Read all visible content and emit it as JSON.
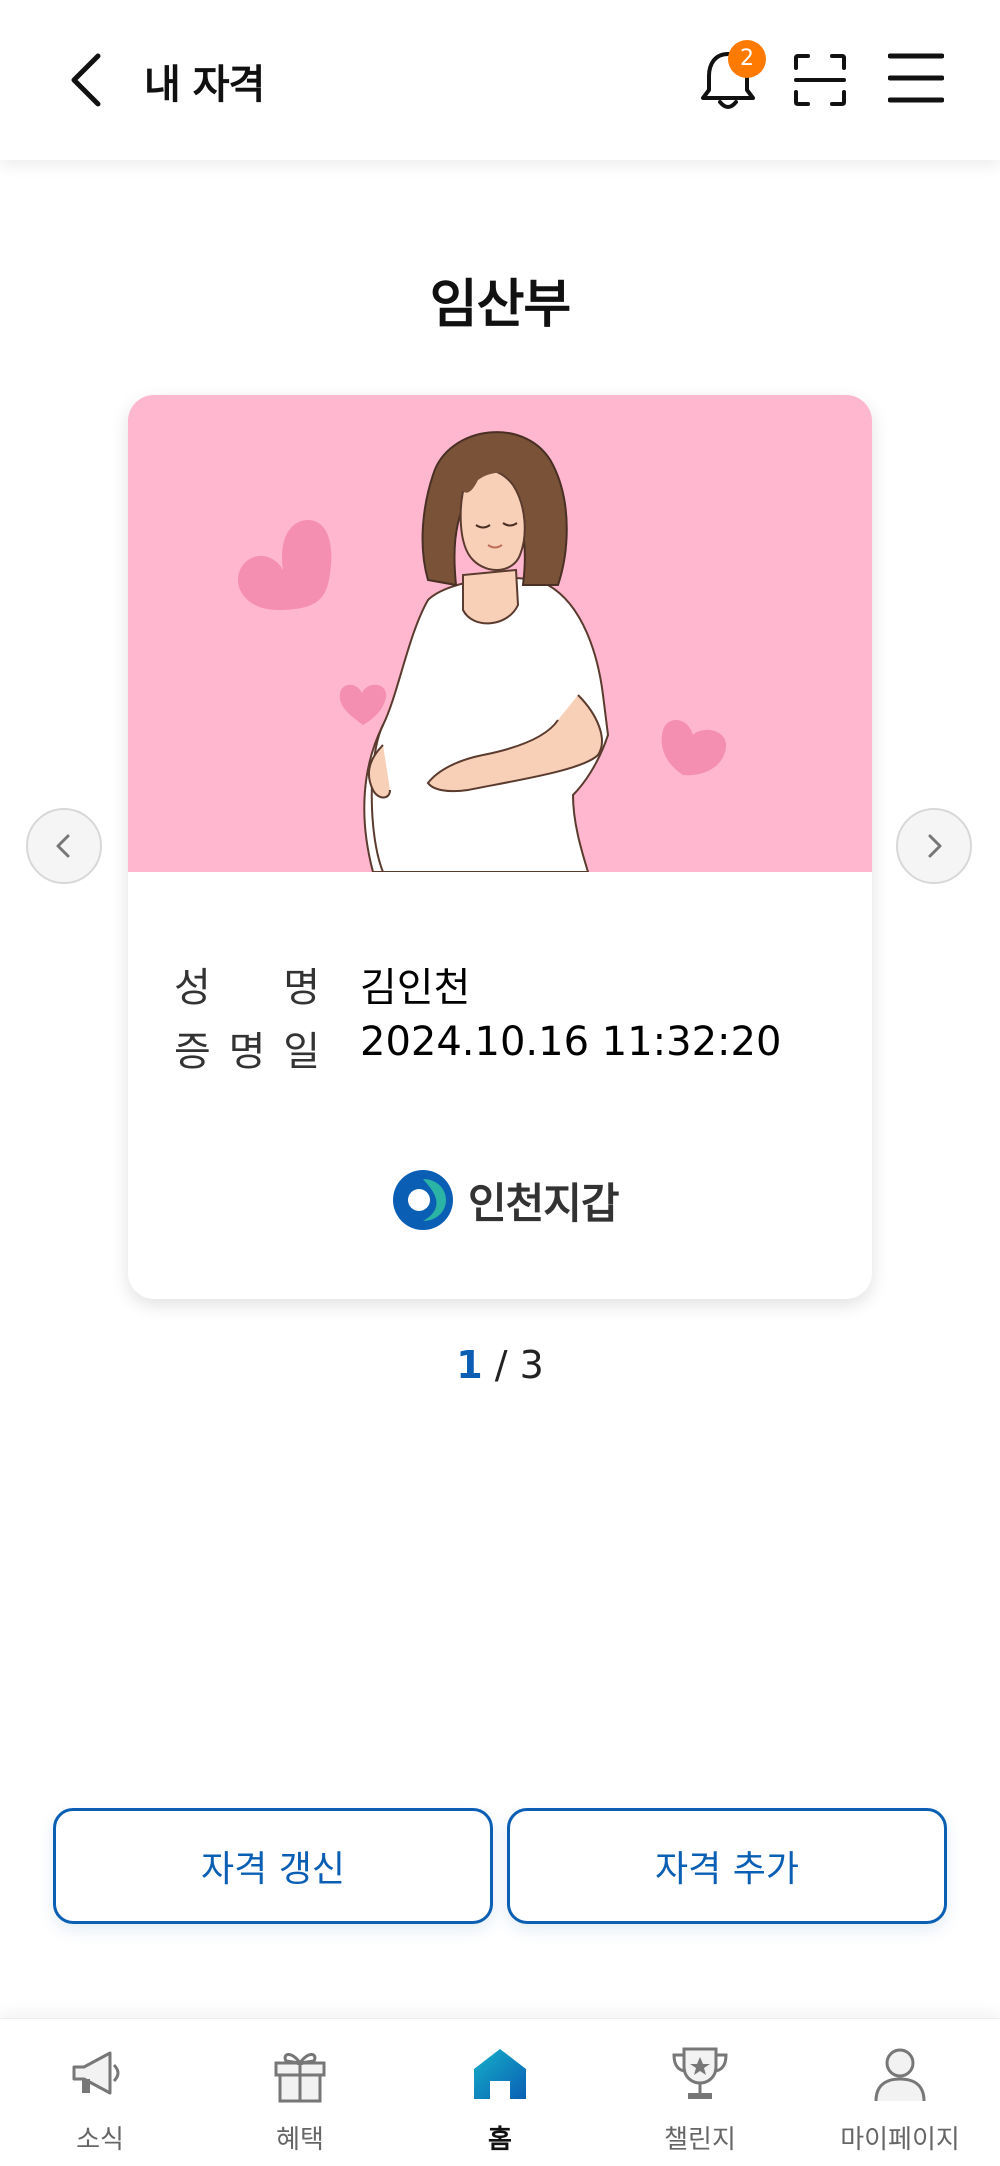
{
  "header": {
    "title": "내 자격",
    "notification_count": "2"
  },
  "qualification": {
    "title": "임산부"
  },
  "card": {
    "name_label_chars": [
      "성",
      "명"
    ],
    "name_value": "김인천",
    "date_label_chars": [
      "증",
      "명",
      "일"
    ],
    "date_value": "2024.10.16 11:32:20",
    "logo_text": "인천지갑"
  },
  "pager": {
    "current": "1",
    "separator": " / ",
    "total": "3"
  },
  "actions": {
    "renew_label": "자격 갱신",
    "add_label": "자격 추가"
  },
  "bottom_nav": [
    {
      "label": "소식",
      "icon": "megaphone-icon"
    },
    {
      "label": "혜택",
      "icon": "gift-icon"
    },
    {
      "label": "홈",
      "icon": "home-icon",
      "active": true
    },
    {
      "label": "챌린지",
      "icon": "trophy-icon"
    },
    {
      "label": "마이페이지",
      "icon": "person-icon"
    }
  ],
  "colors": {
    "accent": "#0a5fb4",
    "badge": "#ff7a00",
    "card_background": "#ffb6cf",
    "heart": "#f48fb1"
  }
}
